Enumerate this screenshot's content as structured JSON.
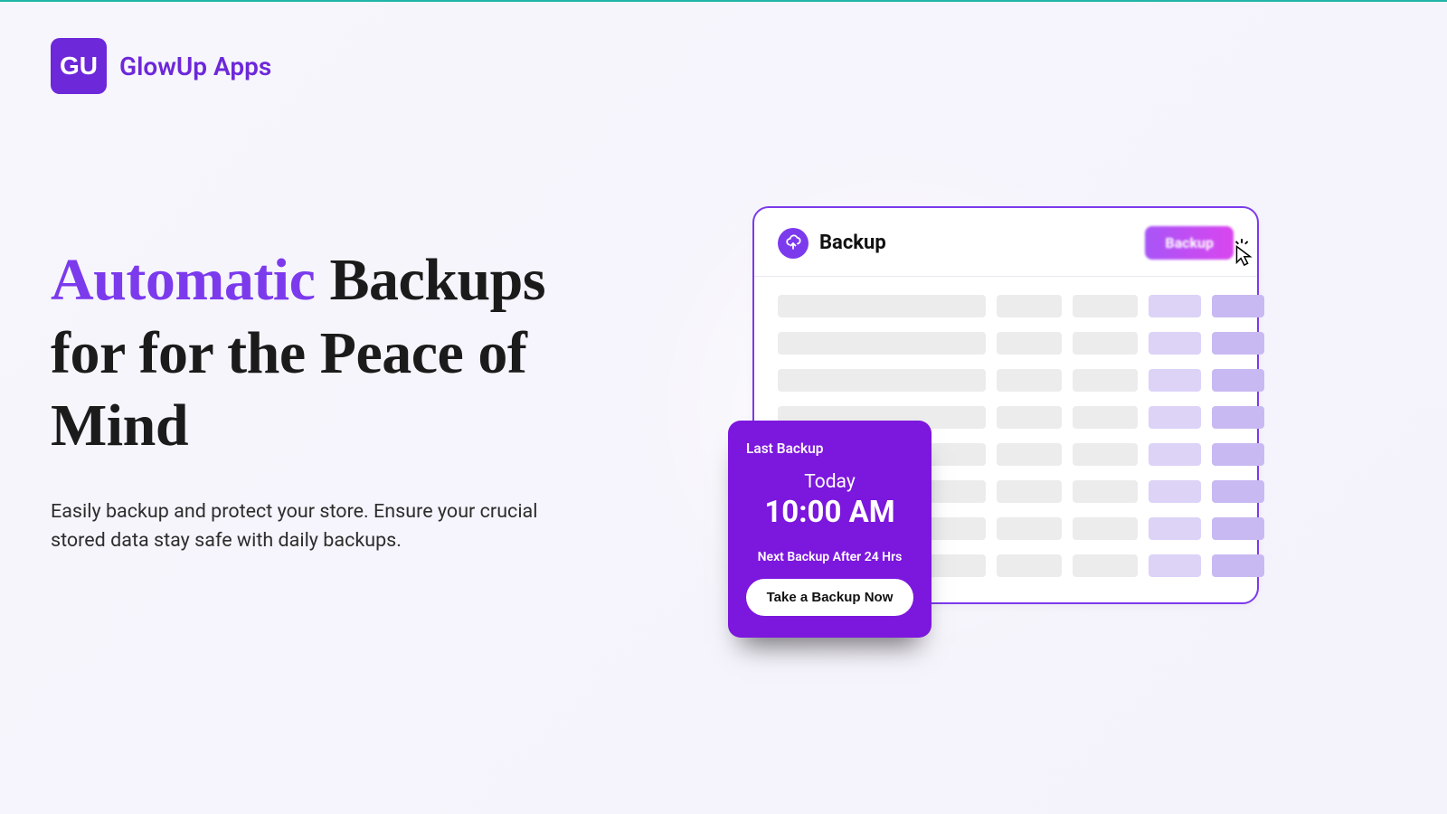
{
  "brand": {
    "name": "GlowUp Apps",
    "logo_text": "GU"
  },
  "hero": {
    "accent_word": "Automatic",
    "rest_line1": " Backups",
    "rest_line2": "for for the Peace of Mind",
    "subtext": "Easily backup and protect your store. Ensure your crucial stored data stay safe with daily backups."
  },
  "panel": {
    "title": "Backup",
    "backup_button": "Backup"
  },
  "card": {
    "label": "Last Backup",
    "day": "Today",
    "time": "10:00 AM",
    "next": "Next Backup After 24 Hrs",
    "cta": "Take a Backup Now"
  }
}
